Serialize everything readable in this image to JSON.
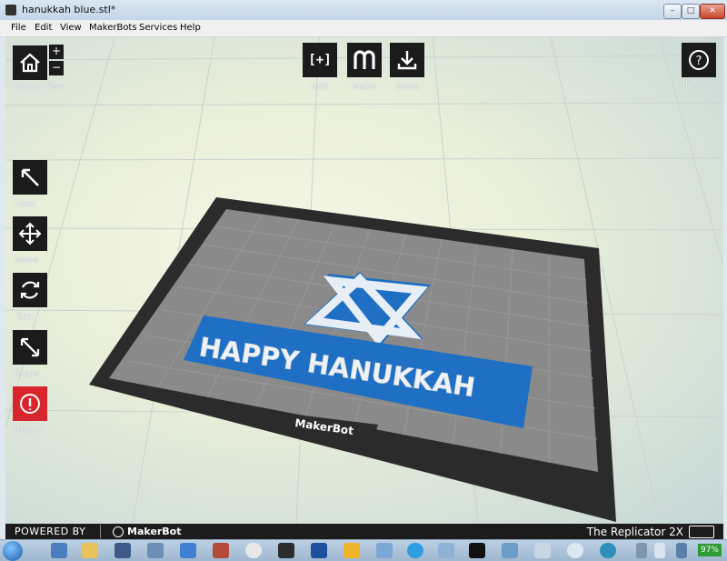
{
  "window": {
    "title": "hanukkah blue.stl*",
    "controls": {
      "minimize": "–",
      "maximize": "□",
      "close": "✕"
    }
  },
  "menu": [
    "File",
    "Edit",
    "View",
    "MakerBots",
    "Services",
    "Help"
  ],
  "toolbar": {
    "home_view": "Home View",
    "zoom_in": "+",
    "zoom_out": "−",
    "add": "Add",
    "add_glyph": "[+]",
    "make": "Make",
    "save": "Save",
    "help": "Help!",
    "help_glyph": "?"
  },
  "side_tools": {
    "look": "Look",
    "move": "Move",
    "turn": "Turn",
    "scale": "Scale",
    "object": "Object"
  },
  "model": {
    "line1": "HAPPY HANUKKAH",
    "platform_logo": "MakerBot"
  },
  "status": {
    "powered_by": "POWERED BY",
    "brand": "MakerBot",
    "printer": "The Replicator 2X"
  },
  "taskbar": {
    "battery": "97%"
  },
  "colors": {
    "model_blue": "#1f6fc4",
    "model_white": "#e7eef6",
    "platform_gray": "#808080",
    "platform_border": "#2a2a2a",
    "object_button": "#d8262c"
  }
}
